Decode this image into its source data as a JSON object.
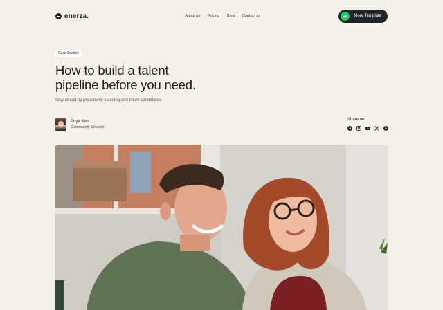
{
  "brand": {
    "name": "enerza."
  },
  "nav": {
    "links": [
      "About us",
      "Pricing",
      "Blog",
      "Contact us"
    ],
    "cta_label": "More Template"
  },
  "article": {
    "tag": "Case Studies",
    "title_line1": "How to build a talent",
    "title_line2": "pipeline before you need.",
    "subtitle": "Stay ahead by proactively sourcing and future candidates."
  },
  "author": {
    "name": "Priya Nair",
    "role": "Community Director"
  },
  "share": {
    "label": "Share on:",
    "icons": [
      "telegram-icon",
      "instagram-icon",
      "youtube-icon",
      "x-icon",
      "facebook-icon"
    ]
  },
  "colors": {
    "background": "#f4f1ea",
    "dark": "#22242b",
    "accent": "#22c55e"
  }
}
